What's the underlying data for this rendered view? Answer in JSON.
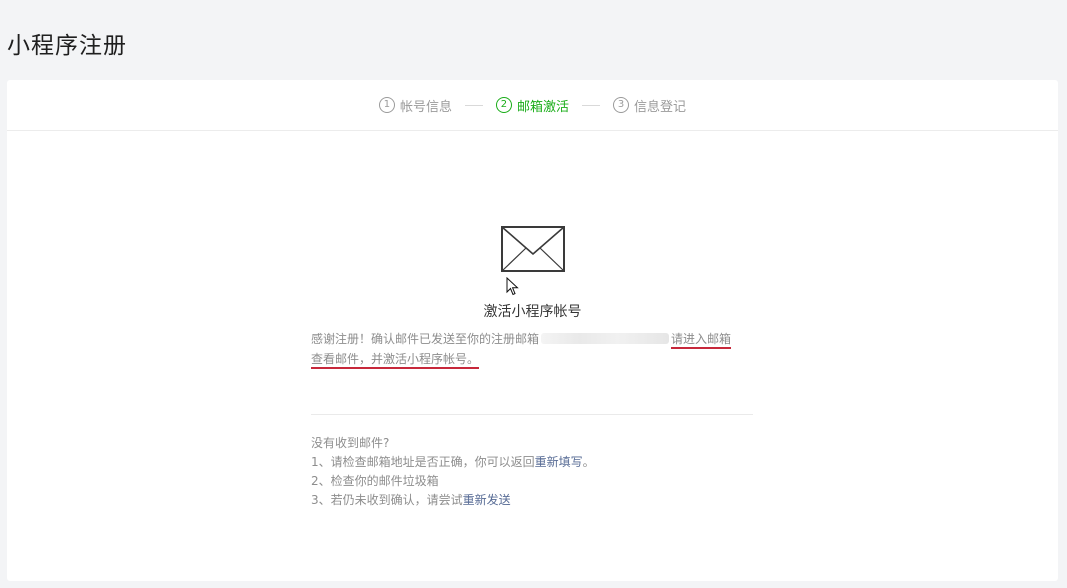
{
  "page": {
    "title": "小程序注册"
  },
  "steps": [
    {
      "num": "1",
      "label": "帐号信息",
      "active": false
    },
    {
      "num": "2",
      "label": "邮箱激活",
      "active": true
    },
    {
      "num": "3",
      "label": "信息登记",
      "active": false
    }
  ],
  "activation": {
    "icon": "mail-envelope-icon",
    "heading": "激活小程序帐号",
    "notice_prefix": "感谢注册！确认邮件已发送至你的注册邮箱",
    "notice_suffix_1": "请进入邮箱",
    "notice_suffix_2": "查看邮件，并激活小程序帐号。"
  },
  "tips": {
    "title": "没有收到邮件?",
    "item1_text": "1、请检查邮箱地址是否正确，你可以返回",
    "item1_link": "重新填写",
    "item1_end": "。",
    "item2_text": "2、检查你的邮件垃圾箱",
    "item3_text": "3、若仍未收到确认，请尝试",
    "item3_link": "重新发送"
  },
  "colors": {
    "active_step": "#1aad19",
    "link": "#576b95",
    "annotation_underline": "#c7283b"
  }
}
